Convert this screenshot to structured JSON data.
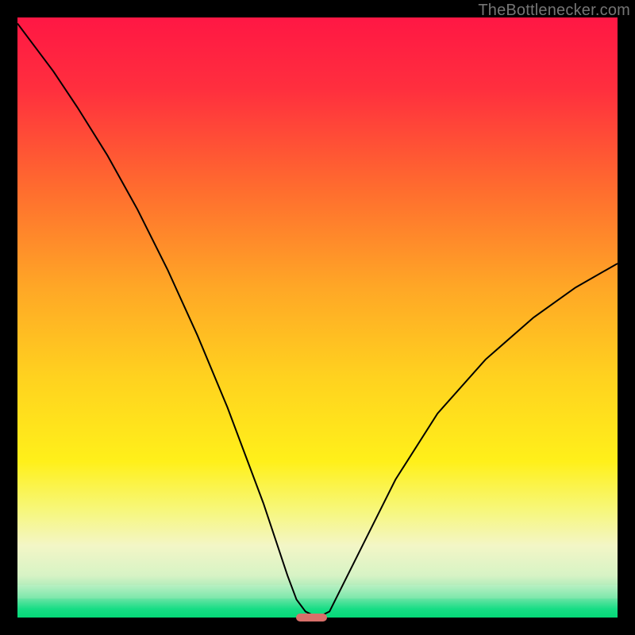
{
  "watermark": {
    "text": "TheBottlenecker.com"
  },
  "chart_data": {
    "type": "line",
    "title": "",
    "xlabel": "",
    "ylabel": "",
    "xlim": [
      0,
      100
    ],
    "ylim": [
      0,
      100
    ],
    "x": [
      0,
      3,
      6,
      10,
      15,
      20,
      25,
      30,
      35,
      38,
      41,
      43,
      45,
      46.5,
      48,
      50,
      52,
      54,
      58,
      63,
      70,
      78,
      86,
      93,
      100
    ],
    "y": [
      99,
      95,
      91,
      85,
      77,
      68,
      58,
      47,
      35,
      27,
      19,
      13,
      7,
      3,
      1,
      0,
      1,
      5,
      13,
      23,
      34,
      43,
      50,
      55,
      59
    ],
    "marker": {
      "x": 49,
      "y": 0,
      "color": "#d9706a",
      "width": 5.2,
      "height": 1.4
    },
    "gradient_stops": [
      {
        "pos": 0.0,
        "color": "#ff1744"
      },
      {
        "pos": 0.12,
        "color": "#ff2f3e"
      },
      {
        "pos": 0.28,
        "color": "#ff6a2f"
      },
      {
        "pos": 0.45,
        "color": "#ffa726"
      },
      {
        "pos": 0.6,
        "color": "#ffd21f"
      },
      {
        "pos": 0.74,
        "color": "#fff01a"
      },
      {
        "pos": 0.82,
        "color": "#f7f77a"
      },
      {
        "pos": 0.88,
        "color": "#f3f6c6"
      },
      {
        "pos": 0.93,
        "color": "#d7f3c5"
      },
      {
        "pos": 0.965,
        "color": "#8de6b0"
      },
      {
        "pos": 0.985,
        "color": "#2fd98f"
      },
      {
        "pos": 1.0,
        "color": "#0fe07f"
      }
    ]
  }
}
